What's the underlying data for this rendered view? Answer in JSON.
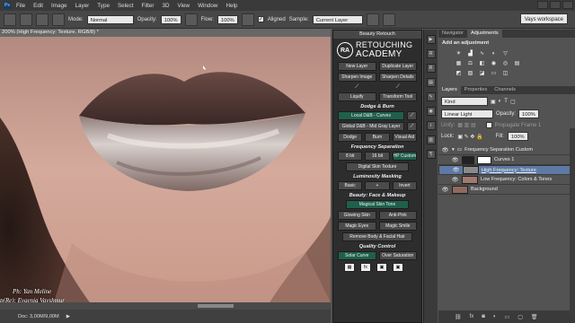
{
  "menu": {
    "app_icon": "Ps",
    "items": [
      "File",
      "Edit",
      "Image",
      "Layer",
      "Type",
      "Select",
      "Filter",
      "3D",
      "View",
      "Window",
      "Help"
    ]
  },
  "options": {
    "mode_label": "Mode:",
    "mode_value": "Normal",
    "opacity_label": "Opacity:",
    "opacity_value": "100%",
    "flow_label": "Flow:",
    "flow_value": "100%",
    "aligned_label": "Aligned",
    "sample_label": "Sample:",
    "sample_value": "Current Layer",
    "workspace": "Vays workspace"
  },
  "document": {
    "tab_title": "200% (High Frequency: Texture, RGB/8) *",
    "status_doc": "Doc: 3,00M/9,00M",
    "credit_line1": "Ph: Yan Meline",
    "credit_line2": "p(Re): Evgenia Vavshmur"
  },
  "retouch": {
    "title": "Beauty Retouch",
    "logo_mark": "RA",
    "logo_line1": "RETOUCHING",
    "logo_line2": "ACADEMY",
    "b_new_layer": "New Layer",
    "b_duplicate": "Duplicate Layer",
    "b_sharpen_image": "Sharpen Image",
    "b_sharpen_details": "Sharpen Details",
    "b_liquify": "Liquify",
    "b_transform": "Transform Tool",
    "sec_dodge": "Dodge & Burn",
    "b_local_db": "Local D&B - Curves",
    "b_global_db": "Global D&B - Mid Gray Layer",
    "b_dodge": "Dodge",
    "b_burn": "Burn",
    "b_visual_aid": "Visual Aid",
    "sec_freq": "Frequency Separation",
    "b_8bit": "8 bit",
    "b_16bit": "16 bit",
    "b_hp": "HP Custom",
    "b_digital_skin": "Digital Skin Texture",
    "sec_lum": "Luminosity Masking",
    "b_basic": "Basic",
    "b_plus": "+",
    "b_invert": "Invert",
    "sec_beauty": "Beauty: Face & Makeup",
    "b_magical": "Magical Skin Tone",
    "b_glowing": "Glowing Skin",
    "b_antipink": "Anti-Pink",
    "b_magic_eyes": "Magic Eyes",
    "b_magic_smile": "Magic Smile",
    "b_remove_body": "Remove Body & Facial Hair",
    "sec_quality": "Quality Control",
    "b_solar": "Solar Curve",
    "b_over_sat": "Over Saturation"
  },
  "panels": {
    "tab_navigator": "Navigator",
    "tab_adjustments": "Adjustments",
    "add_adjustment": "Add an adjustment",
    "tab_layers": "Layers",
    "tab_properties": "Properties",
    "tab_channels": "Channels",
    "kind_label": "Kind",
    "blend_mode": "Linear Light",
    "opacity_label": "Opacity:",
    "opacity_value": "100%",
    "unify_label": "Unify:",
    "propagate_label": "Propagate Frame 1",
    "lock_label": "Lock:",
    "fill_label": "Fill:",
    "fill_value": "100%"
  },
  "layers": [
    {
      "name": "Frequency Separation Custom",
      "type": "group"
    },
    {
      "name": "Curves 1",
      "type": "adjustment"
    },
    {
      "name": "High Frequency: Texture",
      "type": "selected"
    },
    {
      "name": "Low Frequency: Colors & Tones",
      "type": "normal"
    },
    {
      "name": "Background",
      "type": "normal"
    }
  ],
  "colors": {
    "selected_layer": "#5e79a3",
    "active_button": "#1f5f4c"
  }
}
